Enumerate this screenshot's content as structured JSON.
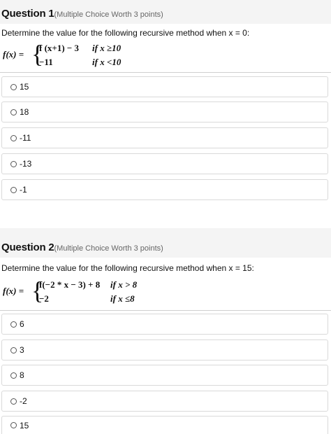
{
  "questions": [
    {
      "title": "Question 1",
      "worth": "(Multiple Choice Worth 3 points)",
      "prompt": "Determine the value for the following recursive method when x = 0:",
      "formula": {
        "lhs": "f(x) =",
        "case1": "f (x+1) − 3",
        "cond1": "if x ≥10",
        "case2": "−11",
        "cond2": "if x <10"
      },
      "options": [
        "15",
        "18",
        "-11",
        "-13",
        "-1"
      ]
    },
    {
      "title": "Question 2",
      "worth": "(Multiple Choice Worth 3 points)",
      "prompt": "Determine the value for the following recursive method when x = 15:",
      "formula": {
        "lhs": "f(x) =",
        "case1": "f(−2 * x − 3) + 8",
        "cond1": "if x > 8",
        "case2": "−2",
        "cond2": "if x ≤8"
      },
      "options": [
        "6",
        "3",
        "8",
        "-2",
        "15"
      ]
    }
  ]
}
